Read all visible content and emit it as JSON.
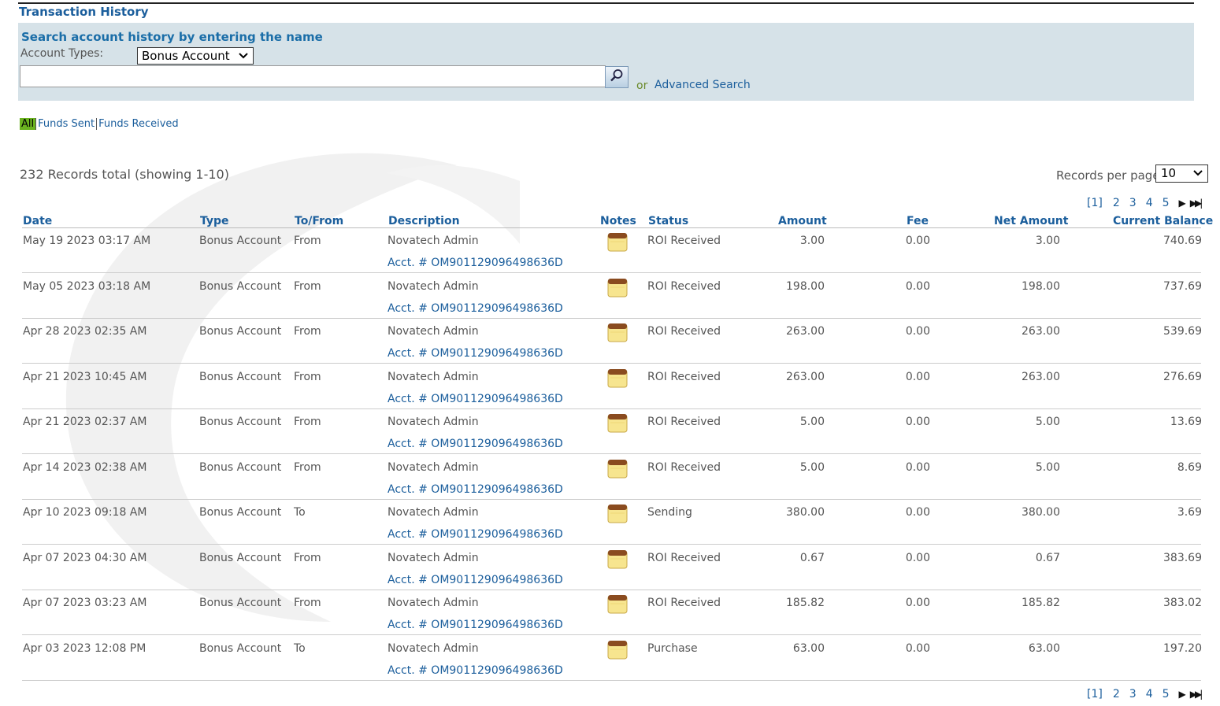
{
  "page_title": "Transaction History",
  "search": {
    "heading": "Search account history by entering the name",
    "account_types_label": "Account Types:",
    "account_type_selected": "Bonus Account",
    "query_value": "",
    "or_text": "or",
    "advanced_search_label": "Advanced Search",
    "search_icon": "magnifier-icon"
  },
  "filters": {
    "all": "All",
    "funds_sent": "Funds Sent",
    "funds_received": "Funds Received"
  },
  "records_total": "232 Records total (showing 1-10)",
  "records_per_page": {
    "label": "Records per page",
    "value": "10"
  },
  "pagination": {
    "current": "[1]",
    "pages": [
      "2",
      "3",
      "4",
      "5"
    ]
  },
  "columns": {
    "date": "Date",
    "type": "Type",
    "to_from": "To/From",
    "description": "Description",
    "notes": "Notes",
    "status": "Status",
    "amount": "Amount",
    "fee": "Fee",
    "net_amount": "Net Amount",
    "current_balance": "Current Balance"
  },
  "rows": [
    {
      "date": "May 19 2023 03:17 AM",
      "type": "Bonus Account",
      "to_from": "From",
      "description": "Novatech Admin",
      "acct": "Acct. # OM901129096498636D",
      "status": "ROI Received",
      "amount": "3.00",
      "fee": "0.00",
      "net": "3.00",
      "balance": "740.69"
    },
    {
      "date": "May 05 2023 03:18 AM",
      "type": "Bonus Account",
      "to_from": "From",
      "description": "Novatech Admin",
      "acct": "Acct. # OM901129096498636D",
      "status": "ROI Received",
      "amount": "198.00",
      "fee": "0.00",
      "net": "198.00",
      "balance": "737.69"
    },
    {
      "date": "Apr 28 2023 02:35 AM",
      "type": "Bonus Account",
      "to_from": "From",
      "description": "Novatech Admin",
      "acct": "Acct. # OM901129096498636D",
      "status": "ROI Received",
      "amount": "263.00",
      "fee": "0.00",
      "net": "263.00",
      "balance": "539.69"
    },
    {
      "date": "Apr 21 2023 10:45 AM",
      "type": "Bonus Account",
      "to_from": "From",
      "description": "Novatech Admin",
      "acct": "Acct. # OM901129096498636D",
      "status": "ROI Received",
      "amount": "263.00",
      "fee": "0.00",
      "net": "263.00",
      "balance": "276.69"
    },
    {
      "date": "Apr 21 2023 02:37 AM",
      "type": "Bonus Account",
      "to_from": "From",
      "description": "Novatech Admin",
      "acct": "Acct. # OM901129096498636D",
      "status": "ROI Received",
      "amount": "5.00",
      "fee": "0.00",
      "net": "5.00",
      "balance": "13.69"
    },
    {
      "date": "Apr 14 2023 02:38 AM",
      "type": "Bonus Account",
      "to_from": "From",
      "description": "Novatech Admin",
      "acct": "Acct. # OM901129096498636D",
      "status": "ROI Received",
      "amount": "5.00",
      "fee": "0.00",
      "net": "5.00",
      "balance": "8.69"
    },
    {
      "date": "Apr 10 2023 09:18 AM",
      "type": "Bonus Account",
      "to_from": "To",
      "description": "Novatech Admin",
      "acct": "Acct. # OM901129096498636D",
      "status": "Sending",
      "amount": "380.00",
      "fee": "0.00",
      "net": "380.00",
      "balance": "3.69"
    },
    {
      "date": "Apr 07 2023 04:30 AM",
      "type": "Bonus Account",
      "to_from": "From",
      "description": "Novatech Admin",
      "acct": "Acct. # OM901129096498636D",
      "status": "ROI Received",
      "amount": "0.67",
      "fee": "0.00",
      "net": "0.67",
      "balance": "383.69"
    },
    {
      "date": "Apr 07 2023 03:23 AM",
      "type": "Bonus Account",
      "to_from": "From",
      "description": "Novatech Admin",
      "acct": "Acct. # OM901129096498636D",
      "status": "ROI Received",
      "amount": "185.82",
      "fee": "0.00",
      "net": "185.82",
      "balance": "383.02"
    },
    {
      "date": "Apr 03 2023 12:08 PM",
      "type": "Bonus Account",
      "to_from": "To",
      "description": "Novatech Admin",
      "acct": "Acct. # OM901129096498636D",
      "status": "Purchase",
      "amount": "63.00",
      "fee": "0.00",
      "net": "63.00",
      "balance": "197.20"
    }
  ],
  "colors": {
    "link": "#1b5e9c",
    "panel_bg": "#d6e2e8",
    "active_filter": "#6ab21f",
    "text": "#555555"
  }
}
